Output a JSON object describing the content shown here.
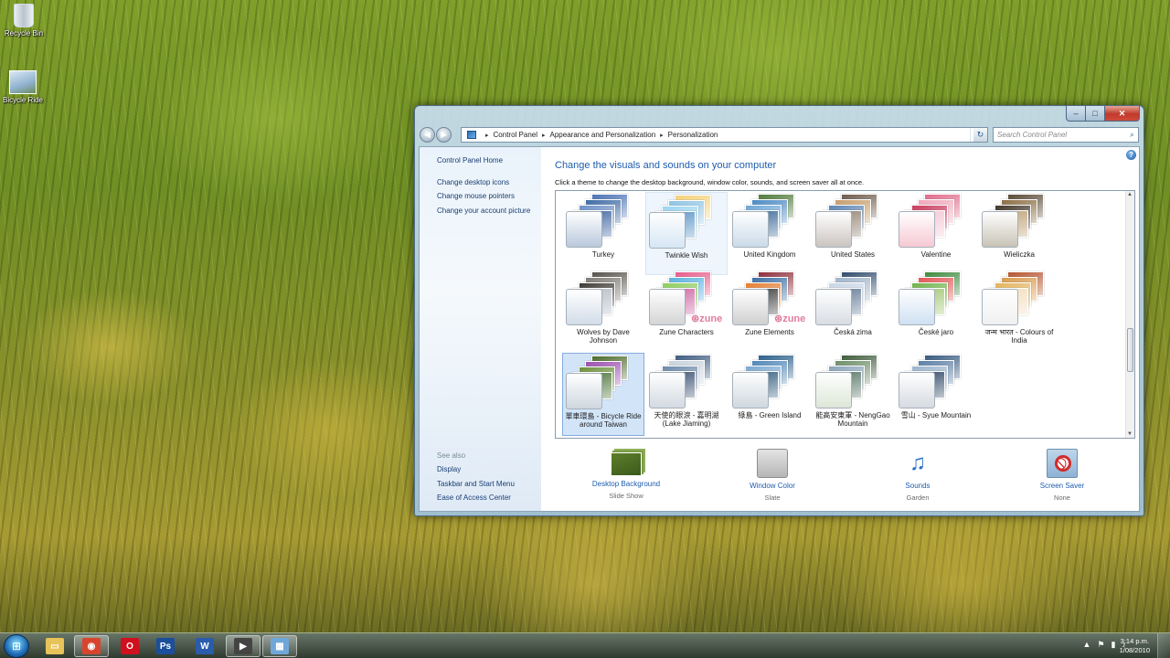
{
  "desktop": {
    "icons": [
      {
        "label": "Recycle Bin"
      },
      {
        "label": "Bicycle Ride"
      }
    ]
  },
  "window": {
    "caption": {
      "minimize": "–",
      "maximize": "□",
      "close": "✕"
    },
    "nav": {
      "back": "◀",
      "forward": "▶",
      "refresh": "↻"
    },
    "breadcrumb": [
      "Control Panel",
      "Appearance and Personalization",
      "Personalization"
    ],
    "search": {
      "placeholder": "Search Control Panel"
    },
    "sidebar": {
      "home": "Control Panel Home",
      "links": [
        "Change desktop icons",
        "Change mouse pointers",
        "Change your account picture"
      ],
      "see_also_title": "See also",
      "see_also": [
        "Display",
        "Taskbar and Start Menu",
        "Ease of Access Center"
      ]
    },
    "main": {
      "title": "Change the visuals and sounds on your computer",
      "description": "Click a theme to change the desktop background, window color, sounds, and screen saver all at once."
    },
    "themes": [
      {
        "name": "Turkey",
        "swatch": "#b9c9dc",
        "colors": [
          "#4a72b5",
          "#3c6aa4",
          "#6c8fc6",
          "#2f5a9a"
        ]
      },
      {
        "name": "Twinkle Wish",
        "swatch": "#d6e6f4",
        "colors": [
          "#f4d17a",
          "#8cc3e4",
          "#9bd4ef",
          "#4e8cc2"
        ],
        "state": "hover"
      },
      {
        "name": "United Kingdom",
        "swatch": "#cbdbe9",
        "colors": [
          "#4f7a3a",
          "#4b89c2",
          "#6ea7d8",
          "#2d5f90"
        ]
      },
      {
        "name": "United States",
        "swatch": "#cbc4c0",
        "colors": [
          "#6d5a4a",
          "#c79d6a",
          "#5b84b3",
          "#8a7a6a"
        ]
      },
      {
        "name": "Valentine",
        "swatch": "#f6c9d3",
        "colors": [
          "#e06b8b",
          "#f0a8bb",
          "#c9385c",
          "#f3c1cf"
        ]
      },
      {
        "name": "Wieliczka",
        "swatch": "#c8c3b5",
        "colors": [
          "#5a4a36",
          "#8a6d44",
          "#3f3426",
          "#b79a6a"
        ]
      },
      {
        "name": "Wolves by Dave Johnson",
        "swatch": "#d2dce8",
        "colors": [
          "#55504a",
          "#7d7a74",
          "#3a3631",
          "#aeb6c0"
        ]
      },
      {
        "name": "Zune Characters",
        "swatch": "#d4d4d4",
        "colors": [
          "#e85b8a",
          "#5ab2e0",
          "#8ccb5b",
          "#c95a9b"
        ],
        "zune": "⊛zune"
      },
      {
        "name": "Zune Elements",
        "swatch": "#d0d0d0",
        "colors": [
          "#8c2d3a",
          "#3b6ea3",
          "#e57b2f",
          "#2f2f2f"
        ],
        "zune": "⊛zune"
      },
      {
        "name": "Česká zima",
        "swatch": "#d9dde3",
        "colors": [
          "#2f4a6b",
          "#9fb3c9",
          "#c8d5e4",
          "#56708e"
        ]
      },
      {
        "name": "České jaro",
        "swatch": "#cfe0f2",
        "colors": [
          "#3b8a3b",
          "#e25454",
          "#6db24a",
          "#9cc36b"
        ]
      },
      {
        "name": "जन्म भारत - Colours of India",
        "swatch": "#f0f0f0",
        "colors": [
          "#b5542f",
          "#d89a4a",
          "#e2b25a",
          "#f3d9b9"
        ]
      },
      {
        "name": "單車環島 - Bicycle Ride around Taiwan",
        "swatch": "#cfd7df",
        "colors": [
          "#4d6b2a",
          "#9b4fb0",
          "#6b8f3a",
          "#3f6b2c"
        ],
        "state": "selected"
      },
      {
        "name": "天使的眼淚 - 嘉明湖 (Lake Jiaming)",
        "swatch": "#d3dae1",
        "colors": [
          "#3c5b80",
          "#c8d2dc",
          "#6a88aa",
          "#2b4366"
        ]
      },
      {
        "name": "綠島 - Green Island",
        "swatch": "#cfd8df",
        "colors": [
          "#2a5f8a",
          "#4d86b8",
          "#7aa8cf",
          "#235277"
        ]
      },
      {
        "name": "能高安東軍 - NengGao Mountain",
        "swatch": "#dde6d7",
        "colors": [
          "#3d5a3a",
          "#6c8e66",
          "#8aa3b8",
          "#4a6a5a"
        ]
      },
      {
        "name": "雪山 - Syue Mountain",
        "swatch": "#d6dbe1",
        "colors": [
          "#36587e",
          "#5b7ea4",
          "#9ab3cc",
          "#203c5c"
        ]
      }
    ],
    "controls": [
      {
        "label": "Desktop Background",
        "value": "Slide Show"
      },
      {
        "label": "Window Color",
        "value": "Slate"
      },
      {
        "label": "Sounds",
        "value": "Garden"
      },
      {
        "label": "Screen Saver",
        "value": "None"
      }
    ],
    "help": "?"
  },
  "taskbar": {
    "start": "⊞",
    "apps": [
      {
        "icon": "▭",
        "color": "#e8c35a"
      },
      {
        "icon": "◉",
        "color": "#d8452f"
      },
      {
        "icon": "O",
        "color": "#d0101e"
      },
      {
        "icon": "Ps",
        "color": "#1b4f9b"
      },
      {
        "icon": "W",
        "color": "#2a5cab"
      },
      {
        "icon": "▶",
        "color": "#444444"
      },
      {
        "icon": "▦",
        "color": "#6fa7d8"
      }
    ],
    "tray": [
      "▲",
      "⚑",
      "▮",
      "♪"
    ],
    "time": "3:14 p.m.",
    "date": "1/08/2010"
  }
}
